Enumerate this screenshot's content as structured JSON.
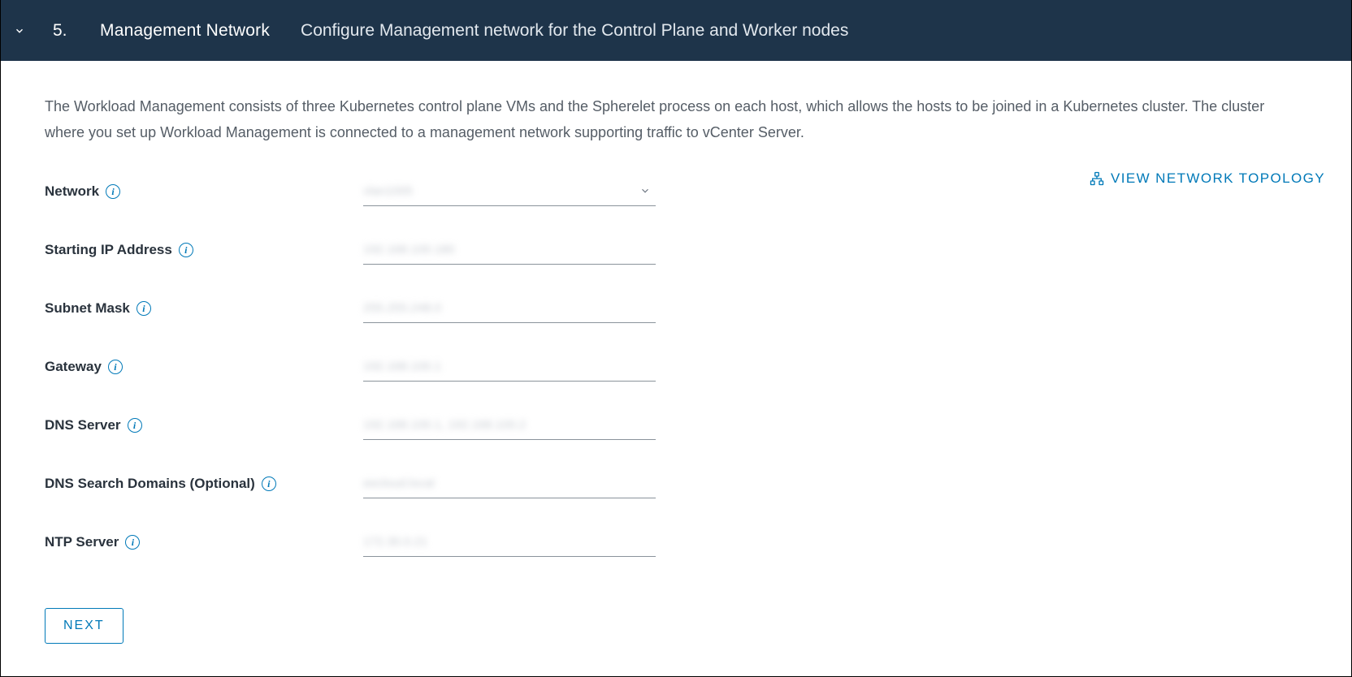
{
  "header": {
    "step_number": "5.",
    "title": "Management Network",
    "subtitle": "Configure Management network for the Control Plane and Worker nodes"
  },
  "description": "The Workload Management consists of three Kubernetes control plane VMs and the Spherelet process on each host, which allows the hosts to be joined in a Kubernetes cluster. The cluster where you set up Workload Management is connected to a management network supporting traffic to vCenter Server.",
  "topology_link": "VIEW NETWORK TOPOLOGY",
  "form": {
    "network": {
      "label": "Network"
    },
    "starting_ip": {
      "label": "Starting IP Address"
    },
    "subnet_mask": {
      "label": "Subnet Mask"
    },
    "gateway": {
      "label": "Gateway"
    },
    "dns_server": {
      "label": "DNS Server"
    },
    "dns_search_domains": {
      "label": "DNS Search Domains (Optional)"
    },
    "ntp_server": {
      "label": "NTP Server"
    }
  },
  "buttons": {
    "next": "NEXT"
  }
}
